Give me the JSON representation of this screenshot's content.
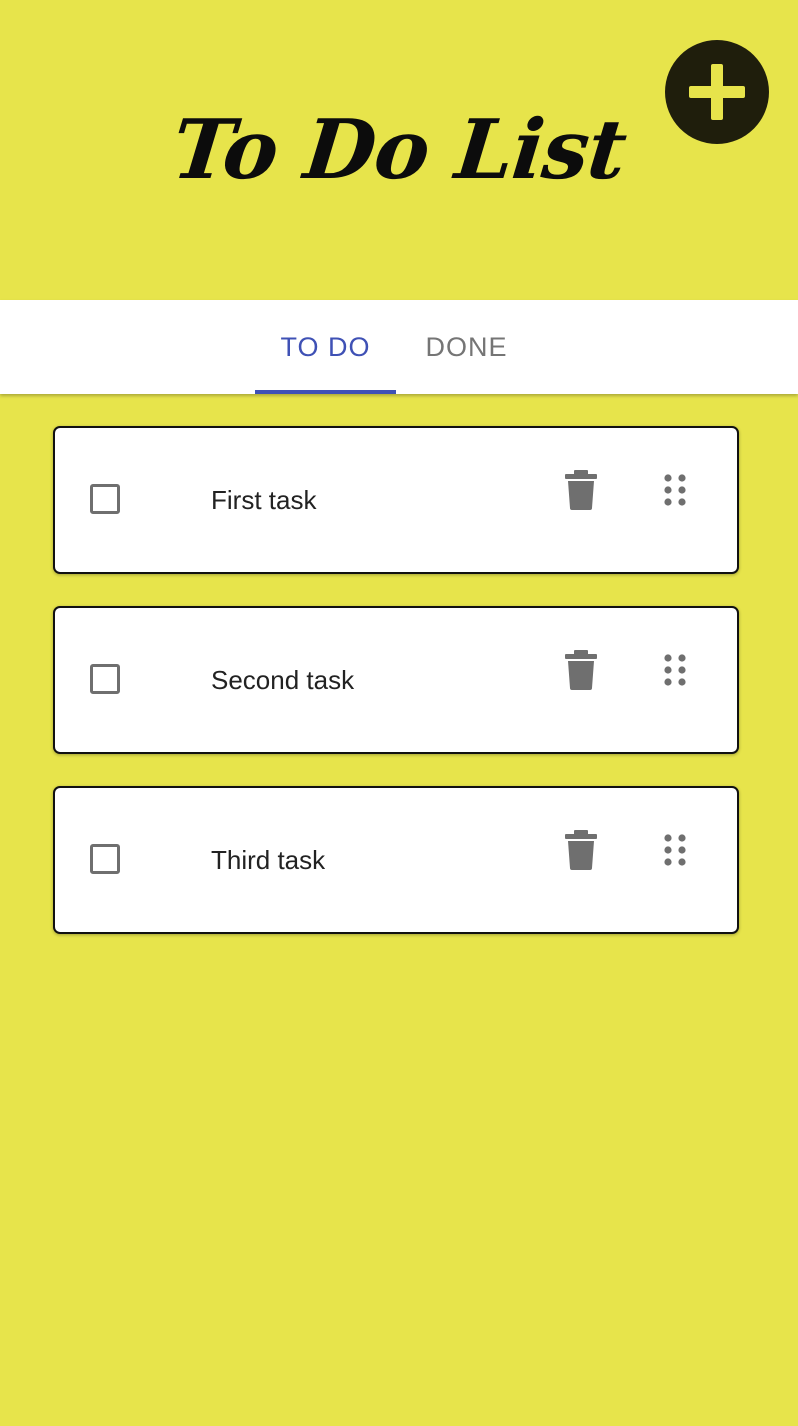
{
  "app": {
    "title": "To Do List"
  },
  "colors": {
    "background": "#e7e44b",
    "accent": "#3f51b5",
    "fab_background": "#1f1e0c",
    "fab_icon": "#e7e44b",
    "icon_gray": "#6f6f6f"
  },
  "fab": {
    "icon": "plus-icon"
  },
  "tabs": [
    {
      "label": "TO DO",
      "selected": true
    },
    {
      "label": "DONE",
      "selected": false
    }
  ],
  "tasks": [
    {
      "label": "First task",
      "checked": false
    },
    {
      "label": "Second task",
      "checked": false
    },
    {
      "label": "Third task",
      "checked": false
    }
  ],
  "task_icons": {
    "delete": "trash-icon",
    "drag": "drag-handle-icon"
  }
}
